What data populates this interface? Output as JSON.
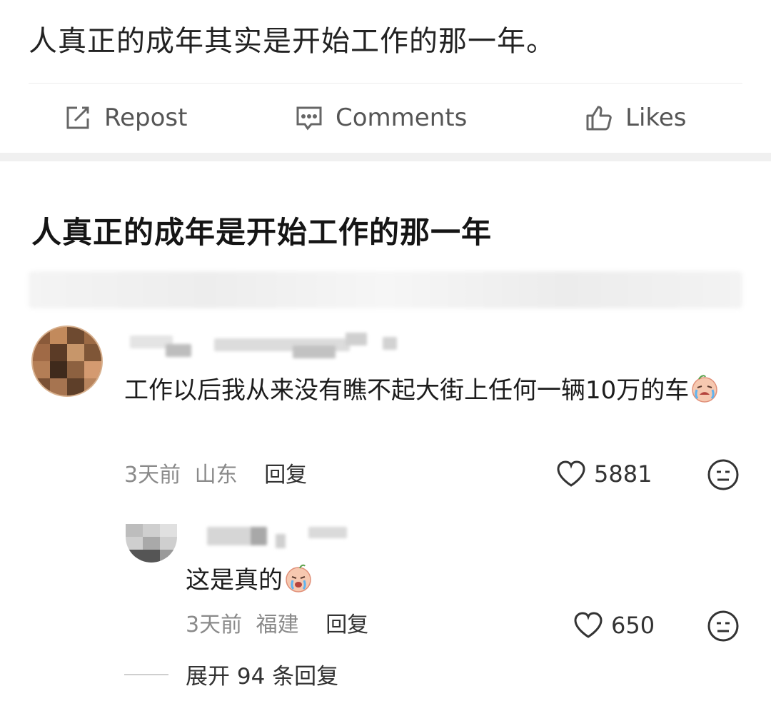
{
  "post": {
    "text": "人真正的成年其实是开始工作的那一年。"
  },
  "actions": {
    "repost_label": "Repost",
    "comments_label": "Comments",
    "likes_label": "Likes"
  },
  "article": {
    "title": "人真正的成年是开始工作的那一年"
  },
  "comment": {
    "text": "工作以后我从来没有瞧不起大街上任何一辆10万的车",
    "time": "3天前",
    "location": "山东",
    "reply_label": "回复",
    "likes": "5881",
    "reply": {
      "text": "这是真的",
      "time": "3天前",
      "location": "福建",
      "reply_label": "回复",
      "likes": "650"
    },
    "expand_label": "展开 94 条回复"
  },
  "icons": {
    "repost": "edit-square-icon",
    "comments": "chat-bubble-icon",
    "likes": "thumbs-up-icon",
    "like": "heart-icon",
    "reaction": "neutral-face-icon",
    "emoji": "crying-face-emoji"
  },
  "colors": {
    "text": "#1c1c1c",
    "muted": "#8a8a8a",
    "divider": "#f0f0f0"
  }
}
